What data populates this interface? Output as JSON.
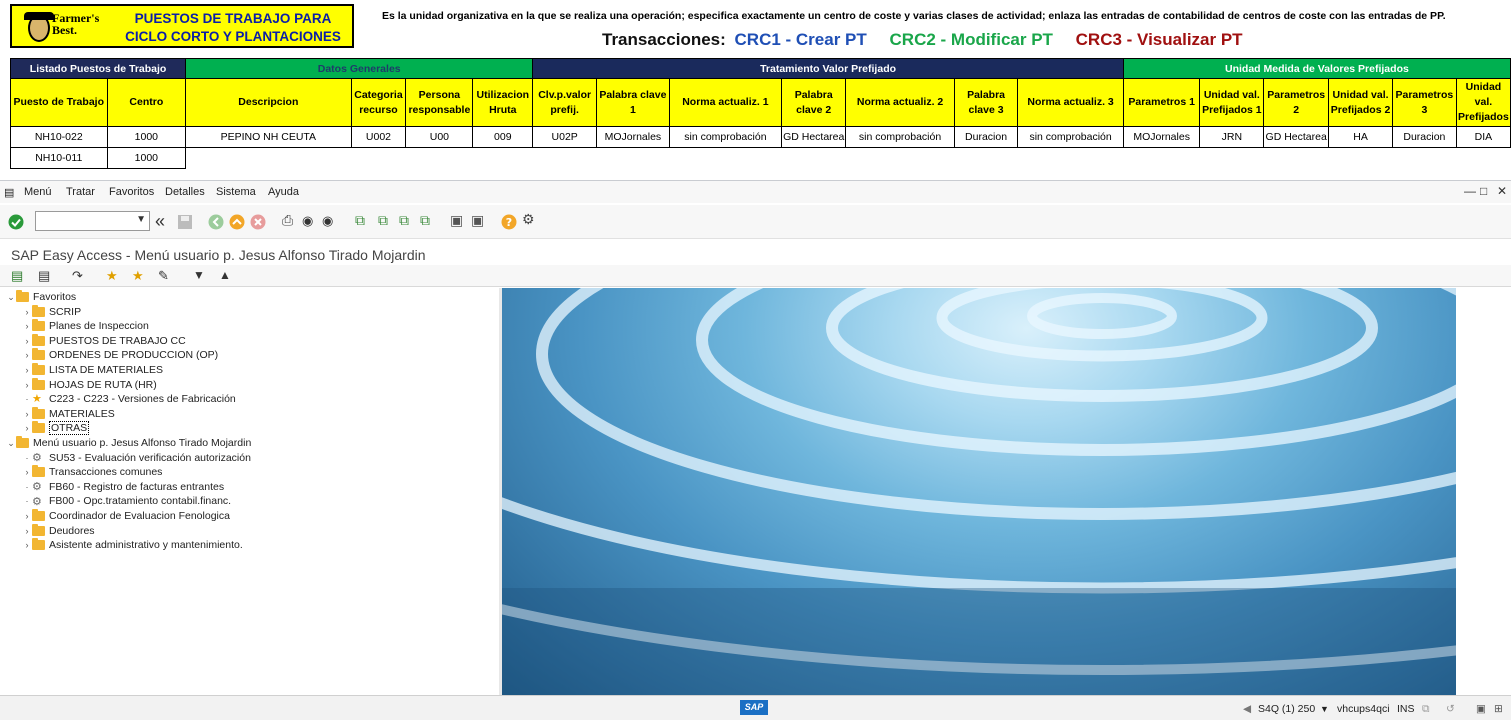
{
  "excel": {
    "logo_text_1": "Farmer's",
    "logo_text_2": "Best.",
    "title_line1": "PUESTOS DE TRABAJO PARA",
    "title_line2": "CICLO CORTO Y PLANTACIONES",
    "description": "Es la unidad organizativa en la que se realiza una operación; especifica exactamente un centro de coste y varias clases de actividad; enlaza las entradas de contabilidad de centros de coste con las entradas de PP.",
    "transactions_label": "Transacciones:",
    "crc1": "CRC1 - Crear PT",
    "crc2": "CRC2 - Modificar PT",
    "crc3": "CRC3 - Visualizar PT",
    "colors": {
      "crc1": "#1f4fb5",
      "crc2": "#1aa64a",
      "crc3": "#a01010"
    },
    "group_headers": {
      "listado": "Listado Puestos de Trabajo",
      "datos": "Datos Generales",
      "tratamiento": "Tratamiento Valor Prefijado",
      "unidad": "Unidad Medida de Valores Prefijados"
    },
    "columns": [
      "Puesto de Trabajo",
      "Centro",
      "Descripcion",
      "Categoria recurso",
      "Persona responsable",
      "Utilizacion Hruta",
      "Clv.p.valor prefij.",
      "Palabra clave 1",
      "Norma actualiz. 1",
      "Palabra clave 2",
      "Norma actualiz. 2",
      "Palabra clave 3",
      "Norma actualiz. 3",
      "Parametros 1",
      "Unidad val. Prefijados 1",
      "Parametros 2",
      "Unidad val. Prefijados 2",
      "Parametros 3",
      "Unidad val. Prefijados"
    ],
    "rows": [
      [
        "NH10-022",
        "1000",
        "PEPINO NH CEUTA",
        "U002",
        "U00",
        "009",
        "U02P",
        "MOJornales",
        "sin comprobación",
        "GD Hectarea",
        "sin comprobación",
        "Duracion",
        "sin comprobación",
        "MOJornales",
        "JRN",
        "GD Hectarea",
        "HA",
        "Duracion",
        "DIA"
      ],
      [
        "NH10-011",
        "1000"
      ]
    ]
  },
  "sap": {
    "menu": [
      "Menú",
      "Tratar",
      "Favoritos",
      "Detalles",
      "Sistema",
      "Ayuda"
    ],
    "title": "SAP Easy Access  -  Menú usuario p. Jesus Alfonso Tirado Mojardin",
    "tree": {
      "favoritos": "Favoritos",
      "fav_items": [
        {
          "label": "SCRIP",
          "type": "folder"
        },
        {
          "label": "Planes de Inspeccion",
          "type": "folder"
        },
        {
          "label": "PUESTOS DE TRABAJO CC",
          "type": "folder"
        },
        {
          "label": "ORDENES DE PRODUCCION (OP)",
          "type": "folder"
        },
        {
          "label": "LISTA DE MATERIALES",
          "type": "folder"
        },
        {
          "label": "HOJAS DE RUTA (HR)",
          "type": "folder"
        },
        {
          "label": "C223 - C223 - Versiones de Fabricación",
          "type": "star"
        },
        {
          "label": "MATERIALES",
          "type": "folder"
        },
        {
          "label": "OTRAS",
          "type": "folder"
        }
      ],
      "user_menu": "Menú usuario p. Jesus Alfonso Tirado Mojardin",
      "user_items": [
        {
          "label": "SU53 - Evaluación verificación autorización",
          "type": "gear"
        },
        {
          "label": "Transacciones comunes",
          "type": "folder"
        },
        {
          "label": "FB60 - Registro de facturas entrantes",
          "type": "gear"
        },
        {
          "label": "FB00 - Opc.tratamiento contabil.financ.",
          "type": "gear"
        },
        {
          "label": "Coordinador de Evaluacion Fenologica",
          "type": "folder"
        },
        {
          "label": "Deudores",
          "type": "folder"
        },
        {
          "label": "Asistente administrativo y mantenimiento.",
          "type": "folder"
        }
      ]
    },
    "status": {
      "sap_logo": "SAP",
      "system": "S4Q (1) 250",
      "server": "vhcups4qci",
      "mode": "INS"
    }
  }
}
